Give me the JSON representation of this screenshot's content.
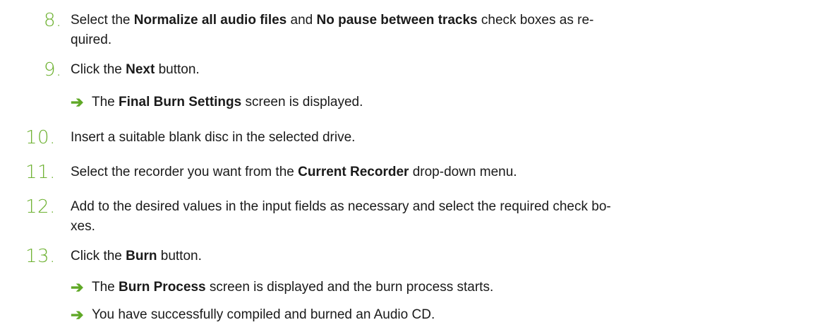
{
  "steps": [
    {
      "number": "8.",
      "line1": [
        "Select the ",
        "Normalize all audio files",
        " and ",
        "No pause between tracks",
        " check boxes as re-"
      ],
      "line2": "quired."
    },
    {
      "number": "9.",
      "parts": [
        "Click the ",
        "Next",
        " button."
      ],
      "result": [
        "The ",
        "Final Burn Settings",
        " screen is displayed."
      ]
    },
    {
      "number": "10.",
      "text": "Insert a suitable blank disc in the selected drive."
    },
    {
      "number": "11.",
      "parts": [
        "Select the recorder you want from the ",
        "Current Recorder",
        " drop-down menu."
      ]
    },
    {
      "number": "12.",
      "line1": "Add to the desired values in the input fields as necessary and select the required check bo-",
      "line2": "xes."
    },
    {
      "number": "13.",
      "parts": [
        "Click the ",
        "Burn",
        " button."
      ],
      "results": [
        [
          "The ",
          "Burn Process",
          " screen is displayed and the burn process starts."
        ],
        [
          "You have successfully compiled and burned an Audio CD."
        ]
      ]
    }
  ],
  "icons": {
    "result_arrow": "arrow-right-icon",
    "arrow_glyph": "➔",
    "arrow_color": "#5fa826",
    "number_color": "#6bb02e"
  }
}
